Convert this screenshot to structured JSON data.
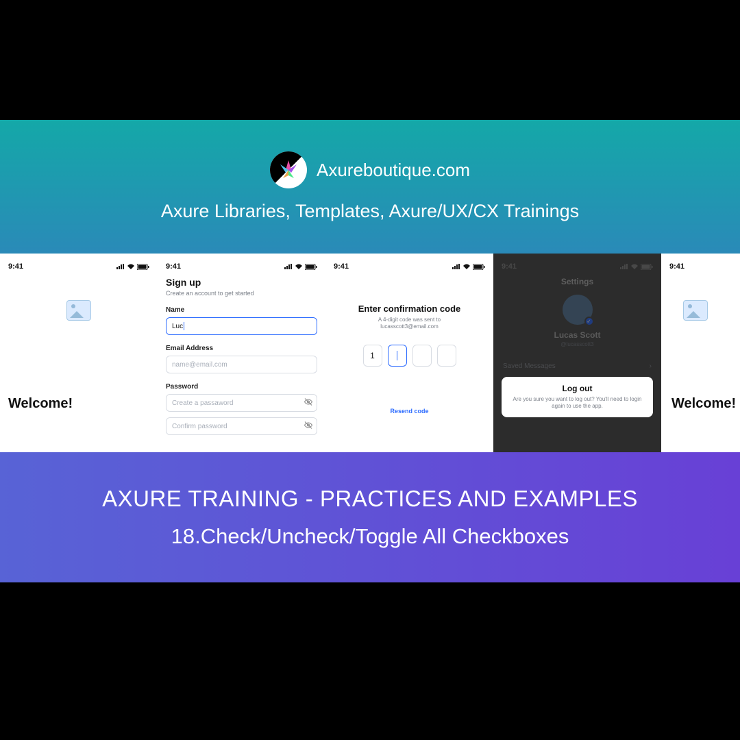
{
  "hero": {
    "brand": "Axureboutique.com",
    "subtitle": "Axure Libraries, Templates,  Axure/UX/CX Trainings"
  },
  "status": {
    "time": "9:41",
    "icons": "􀙇 ■"
  },
  "phones": {
    "welcome": {
      "heading": "Welcome!"
    },
    "signup": {
      "title": "Sign up",
      "subtitle": "Create an account to get started",
      "name_label": "Name",
      "name_value": "Luc",
      "email_label": "Email Address",
      "email_placeholder": "name@email.com",
      "password_label": "Password",
      "password_placeholder": "Create a passaword",
      "confirm_placeholder": "Confirm password"
    },
    "confirm": {
      "title": "Enter confirmation code",
      "subtitle_line1": "A 4-digit code was sent to",
      "subtitle_line2": "lucasscott3@email.com",
      "digit1": "1",
      "resend": "Resend code"
    },
    "settings": {
      "title": "Settings",
      "user_name": "Lucas Scott",
      "user_handle": "@lucasscott3",
      "saved_messages": "Saved Messages",
      "logout_title": "Log out",
      "logout_sub": "Are you sure you want to log out? You'll need to login again to use the app."
    },
    "welcome2": {
      "heading": "Welcome!"
    }
  },
  "banner": {
    "line1": "AXURE TRAINING - PRACTICES AND EXAMPLES",
    "line2": "18.Check/Uncheck/Toggle All Checkboxes"
  }
}
